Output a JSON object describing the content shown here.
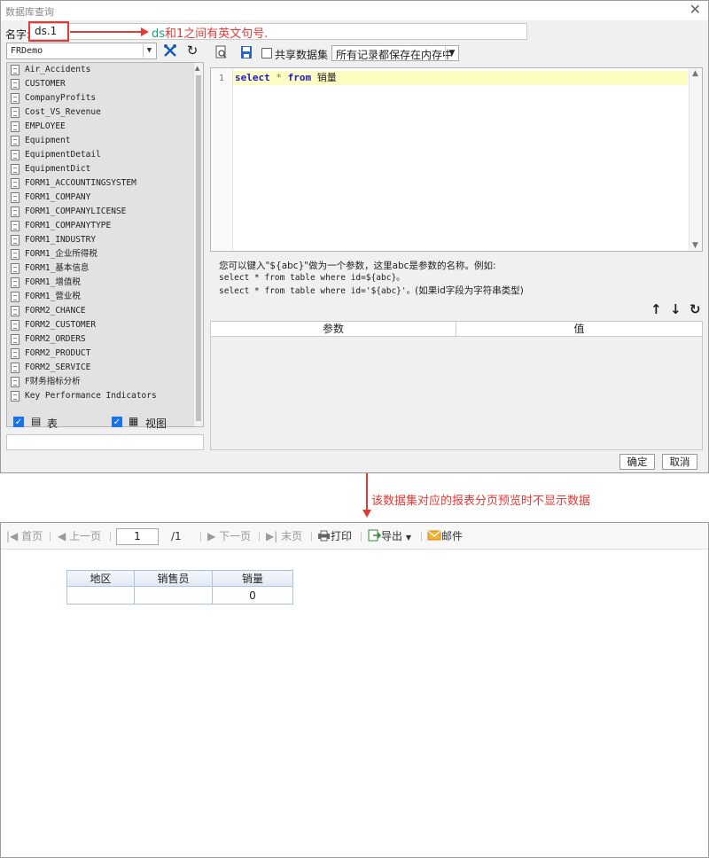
{
  "dialog": {
    "title": "数据库查询",
    "close": "✕",
    "name_label": "名字:",
    "name_value": "ds.1",
    "annotation": {
      "prefix": "ds",
      "rest": "和1之间有英文句号."
    },
    "database": "FRDemo",
    "tables": [
      "Air_Accidents",
      "CUSTOMER",
      "CompanyProfits",
      "Cost_VS_Revenue",
      "EMPLOYEE",
      "Equipment",
      "EquipmentDetail",
      "EquipmentDict",
      "FORM1_ACCOUNTINGSYSTEM",
      "FORM1_COMPANY",
      "FORM1_COMPANYLICENSE",
      "FORM1_COMPANYTYPE",
      "FORM1_INDUSTRY",
      "FORM1_企业所得税",
      "FORM1_基本信息",
      "FORM1_增值税",
      "FORM1_营业税",
      "FORM2_CHANCE",
      "FORM2_CUSTOMER",
      "FORM2_ORDERS",
      "FORM2_PRODUCT",
      "FORM2_SERVICE",
      "F财务指标分析",
      "Key Performance Indicators"
    ],
    "check_table_label": "表",
    "check_view_label": "视图",
    "share_label": "共享数据集",
    "mode_select": "所有记录都保存在内存中",
    "editor": {
      "line_no": "1",
      "kw_select": "select",
      "star": "*",
      "kw_from": "from",
      "table_name": "销量"
    },
    "hint": {
      "line1": "您可以键入\"${abc}\"做为一个参数，这里abc是参数的名称。例如:",
      "line2": "select * from table where id=${abc}。",
      "line3a": "select * from table where id='${abc}'。",
      "line3b": "(如果id字段为字符串类型)"
    },
    "param_header": [
      "参数",
      "值"
    ],
    "ok": "确定",
    "cancel": "取消"
  },
  "middle_note": "该数据集对应的报表分页预览时不显示数据",
  "preview": {
    "toolbar": {
      "first": "首页",
      "prev": "上一页",
      "page_value": "1",
      "page_total": "/1",
      "next": "下一页",
      "last": "末页",
      "print": "打印",
      "export": "导出",
      "mail": "邮件"
    },
    "report": {
      "headers": [
        "地区",
        "销售员",
        "销量"
      ],
      "row": [
        "",
        "",
        "0"
      ]
    }
  },
  "colors": {
    "annotation_red": "#e53935",
    "annotation_green": "#1aa37a",
    "checkbox_blue": "#1a73e8",
    "sql_keyword": "#1a1ad4",
    "editor_highlight": "#fdfdc2"
  }
}
